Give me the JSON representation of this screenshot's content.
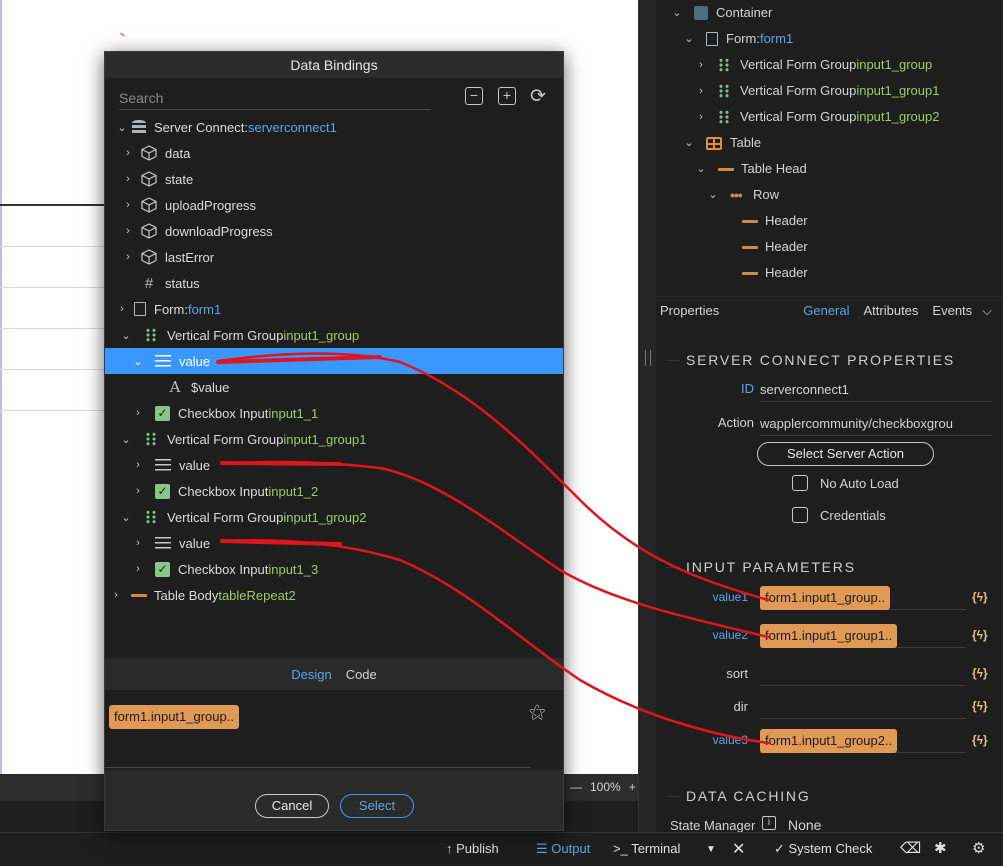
{
  "canvas": {
    "zoom": "100%"
  },
  "structure": {
    "items": [
      {
        "label": "Container",
        "sub": ""
      },
      {
        "label": "Form: ",
        "sub": "form1"
      },
      {
        "label": "Vertical Form Group ",
        "sub": "input1_group"
      },
      {
        "label": "Vertical Form Group ",
        "sub": "input1_group1"
      },
      {
        "label": "Vertical Form Group ",
        "sub": "input1_group2"
      },
      {
        "label": "Table",
        "sub": ""
      },
      {
        "label": "Table Head",
        "sub": ""
      },
      {
        "label": "Row",
        "sub": ""
      },
      {
        "label": "Header",
        "sub": ""
      },
      {
        "label": "Header",
        "sub": ""
      },
      {
        "label": "Header",
        "sub": ""
      }
    ]
  },
  "properties": {
    "title": "Properties",
    "tabs": [
      "General",
      "Attributes",
      "Events"
    ],
    "server_connect_heading": "SERVER CONNECT PROPERTIES",
    "id_label": "ID",
    "id_value": "serverconnect1",
    "action_label": "Action",
    "action_value": "wapplercommunity/checkboxgrou",
    "select_action_button": "Select Server Action",
    "no_auto_load": "No Auto Load",
    "credentials": "Credentials",
    "input_heading": "INPUT PARAMETERS",
    "params": [
      {
        "name": "value1",
        "value": "form1.input1_group.."
      },
      {
        "name": "value2",
        "value": "form1.input1_group1.."
      },
      {
        "name": "sort",
        "value": ""
      },
      {
        "name": "dir",
        "value": ""
      },
      {
        "name": "value3",
        "value": "form1.input1_group2.."
      }
    ],
    "bolt": "{ϟ}",
    "caching_heading": "DATA CACHING",
    "state_manager_label": "State Manager",
    "state_manager_value": "None"
  },
  "statusbar": {
    "publish": "Publish",
    "output": "Output",
    "terminal": "Terminal",
    "system_check": "System Check"
  },
  "dialog": {
    "title": "Data Bindings",
    "search_placeholder": "Search",
    "tree": [
      {
        "label": "Server Connect: ",
        "sub": "serverconnect1"
      },
      {
        "label": "data",
        "sub": ""
      },
      {
        "label": "state",
        "sub": ""
      },
      {
        "label": "uploadProgress",
        "sub": ""
      },
      {
        "label": "downloadProgress",
        "sub": ""
      },
      {
        "label": "lastError",
        "sub": ""
      },
      {
        "label": "status",
        "sub": ""
      },
      {
        "label": "Form: ",
        "sub": "form1"
      },
      {
        "label": "Vertical Form Group ",
        "sub": "input1_group"
      },
      {
        "label": "value",
        "sub": ""
      },
      {
        "label": "$value",
        "sub": ""
      },
      {
        "label": "Checkbox Input ",
        "sub": "input1_1"
      },
      {
        "label": "Vertical Form Group ",
        "sub": "input1_group1"
      },
      {
        "label": "value",
        "sub": ""
      },
      {
        "label": "Checkbox Input ",
        "sub": "input1_2"
      },
      {
        "label": "Vertical Form Group ",
        "sub": "input1_group2"
      },
      {
        "label": "value",
        "sub": ""
      },
      {
        "label": "Checkbox Input ",
        "sub": "input1_3"
      },
      {
        "label": "Table Body ",
        "sub": "tableRepeat2"
      }
    ],
    "tabs": [
      "Design",
      "Code"
    ],
    "expression": "form1.input1_group..",
    "cancel": "Cancel",
    "select": "Select"
  },
  "colors": {
    "accent": "#3a97ff",
    "chip": "#e19a55",
    "annotation": "#e0141c"
  }
}
